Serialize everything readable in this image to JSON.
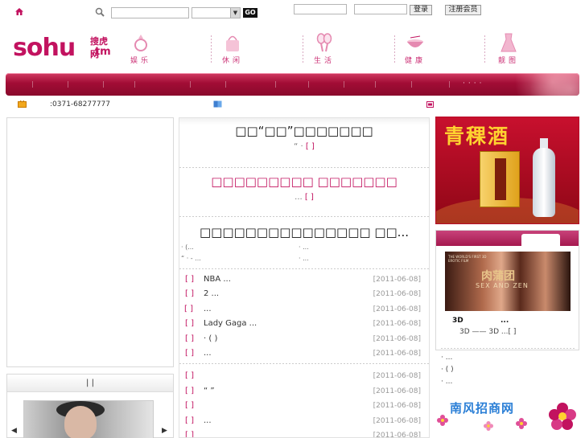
{
  "topbar": {
    "go_label": "GO",
    "login_label": "登录",
    "register_label": "注册会员"
  },
  "logo": {
    "main": "sohu",
    "cn": "搜虎网",
    "tm": ".tm"
  },
  "nav": [
    {
      "label": "娱乐",
      "icon": "ring-icon"
    },
    {
      "label": "休闲",
      "icon": "handbag-icon"
    },
    {
      "label": "生活",
      "icon": "tennis-icon"
    },
    {
      "label": "健康",
      "icon": "bowl-icon"
    },
    {
      "label": "靓图",
      "icon": "dress-icon"
    }
  ],
  "infobar": {
    "phone": ":0371-68277777"
  },
  "left": {
    "box2_header": "|    |"
  },
  "center": {
    "headline1": "□□“□□”□□□□□□□",
    "summary1": "“ ·",
    "summary1_more": "[ ]",
    "headline2": "□□□□□□□□□ □□□□□□□",
    "summary2": "...",
    "summary2_more": "[ ]",
    "headline3": "□□□□□□□□□□□□□□□ □□...",
    "mini1": "·        (...",
    "mini2": "·        ...",
    "mini3": "“    ·  - ...",
    "mini4": "·        ...",
    "news": [
      {
        "bracket": "[ ]",
        "title": "NBA             ...",
        "date": "[2011-06-08]"
      },
      {
        "bracket": "[ ]",
        "title": "           2     ...",
        "date": "[2011-06-08]"
      },
      {
        "bracket": "[ ]",
        "title": "                 ...",
        "date": "[2011-06-08]"
      },
      {
        "bracket": "[ ]",
        "title": "Lady Gaga          ...",
        "date": "[2011-06-08]"
      },
      {
        "bracket": "[ ]",
        "title": "       ·        (  )",
        "date": "[2011-06-08]"
      },
      {
        "bracket": "[ ]",
        "title": "                    ...",
        "date": "[2011-06-08]"
      },
      {
        "bracket": "[ ]",
        "title": "",
        "date": "[2011-06-08]"
      },
      {
        "bracket": "[ ]",
        "title": "       “  ”",
        "date": "[2011-06-08]"
      },
      {
        "bracket": "[ ]",
        "title": "",
        "date": "[2011-06-08]"
      },
      {
        "bracket": "[ ]",
        "title": "                    ...",
        "date": "[2011-06-08]"
      },
      {
        "bracket": "[ ]",
        "title": "",
        "date": "[2011-06-08]"
      }
    ]
  },
  "right": {
    "ad1_title": "青稞酒",
    "movie_logo_cn": "肉蒲团",
    "movie_logo_en": "SEX AND ZEN",
    "movie_tagline": "THE WORLD'S FIRST 3D EROTIC FILM",
    "movie_title": "3D",
    "movie_title_more": "...",
    "movie_desc": "3D    ——  3D        ...[ ]",
    "list": [
      "·         ...",
      "·       ( )",
      "·         ..."
    ],
    "ad2_title": "南风招商网"
  }
}
